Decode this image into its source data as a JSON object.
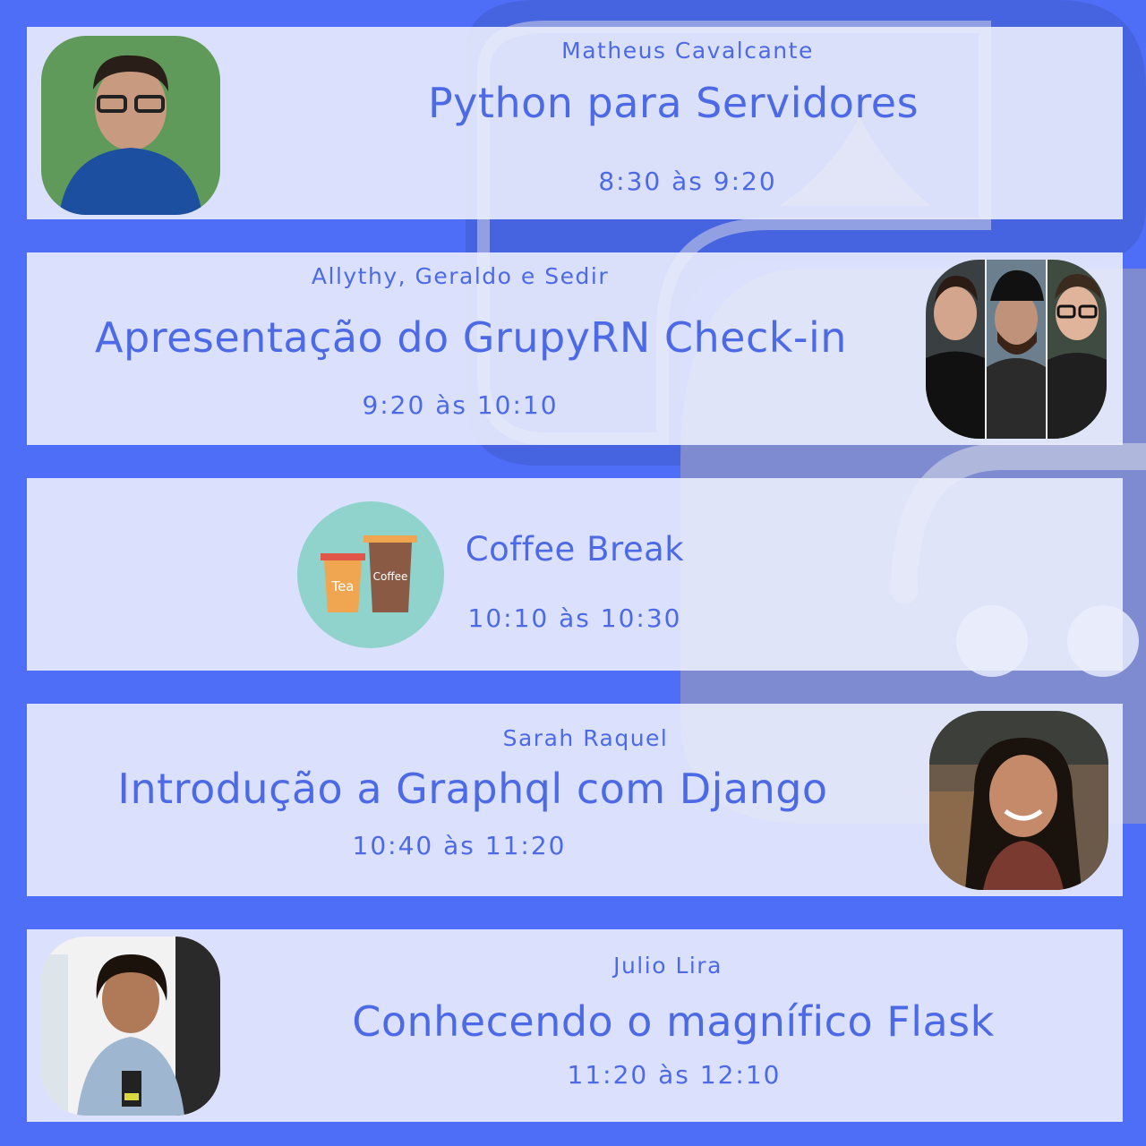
{
  "colors": {
    "background": "#4f6ef7",
    "card": "#eaedfc",
    "text": "#4d6ae6"
  },
  "sessions": [
    {
      "speaker": "Matheus Cavalcante",
      "title": "Python para Servidores",
      "time": "8:30 às 9:20",
      "image": "speaker-photo"
    },
    {
      "speaker": "Allythy, Geraldo e Sedir",
      "title": "Apresentação do GrupyRN Check-in",
      "time": "9:20 às 10:10",
      "image": "speakers-photo-group"
    },
    {
      "title": "Coffee Break",
      "time": "10:10 às 10:30",
      "image": "coffee-cups-icon",
      "cups": [
        "Tea",
        "Coffee"
      ]
    },
    {
      "speaker": "Sarah Raquel",
      "title": "Introdução a Graphql com Django",
      "time": "10:40 às 11:20",
      "image": "speaker-photo"
    },
    {
      "speaker": "Julio Lira",
      "title": "Conhecendo o magnífico Flask",
      "time": "11:20 às 12:10",
      "image": "speaker-photo"
    }
  ]
}
